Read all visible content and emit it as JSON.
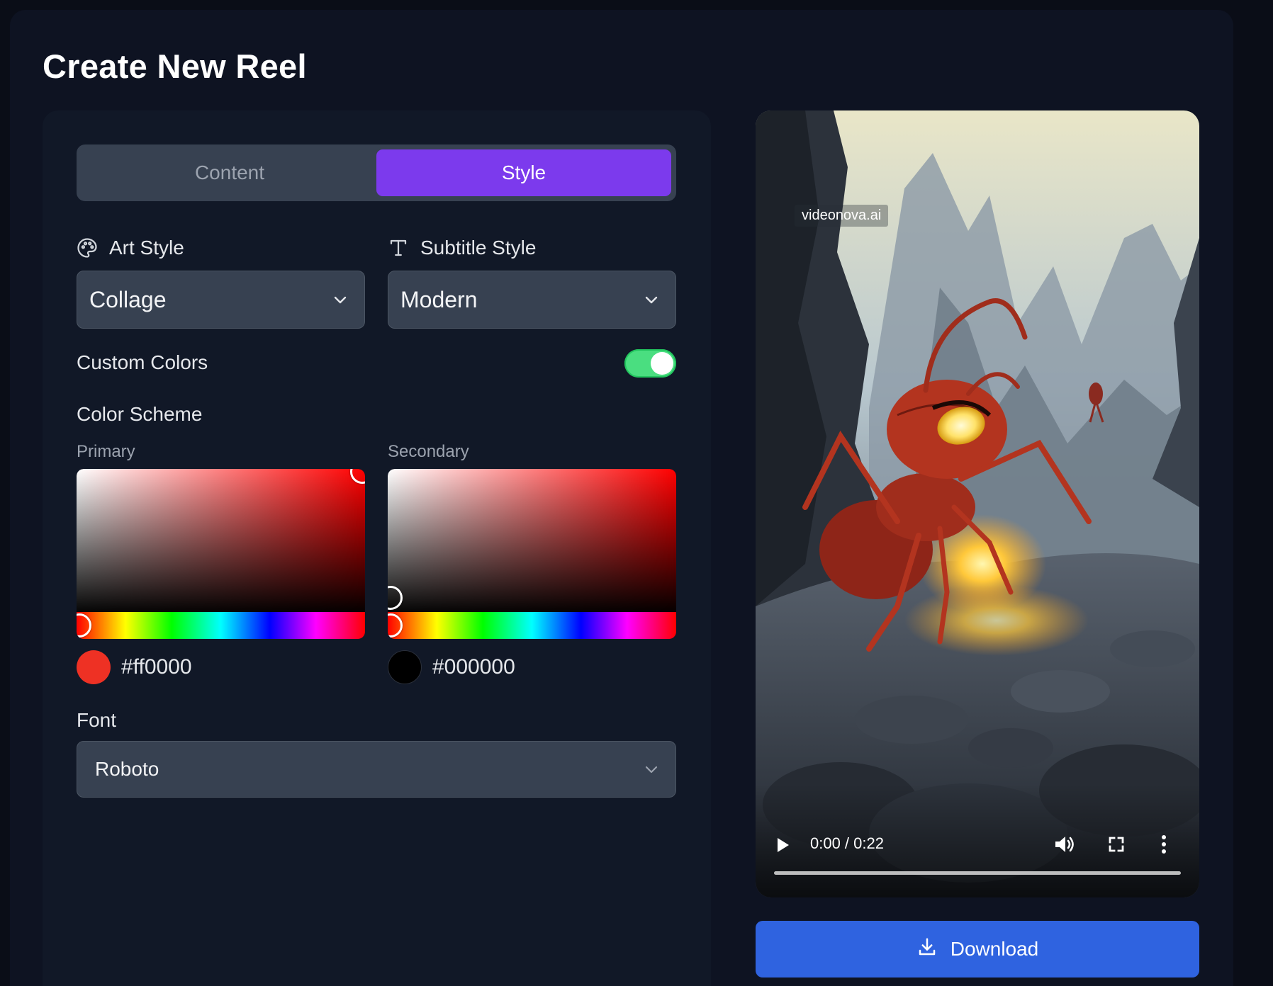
{
  "page": {
    "title": "Create New Reel"
  },
  "tabs": [
    {
      "label": "Content",
      "active": false
    },
    {
      "label": "Style",
      "active": true
    }
  ],
  "art_style": {
    "label": "Art Style",
    "value": "Collage",
    "icon": "palette-icon"
  },
  "subtitle_style": {
    "label": "Subtitle Style",
    "value": "Modern",
    "icon": "text-t-icon"
  },
  "custom_colors": {
    "label": "Custom Colors",
    "enabled": true
  },
  "color_scheme": {
    "title": "Color Scheme",
    "primary": {
      "label": "Primary",
      "hex": "#ff0000",
      "hue_fraction": 0.0
    },
    "secondary": {
      "label": "Secondary",
      "hex": "#000000",
      "hue_fraction": 0.0
    }
  },
  "font": {
    "label": "Font",
    "value": "Roboto"
  },
  "video": {
    "watermark": "videonova.ai",
    "time": "0:00 / 0:22",
    "progress_fraction": 0.0
  },
  "download": {
    "label": "Download",
    "icon": "download-icon"
  },
  "colors": {
    "accent_purple": "#7c3aed",
    "toggle_green": "#4ade80",
    "download_blue": "#2f63e0",
    "primary_swatch": "#ee3124",
    "secondary_swatch": "#000000"
  }
}
